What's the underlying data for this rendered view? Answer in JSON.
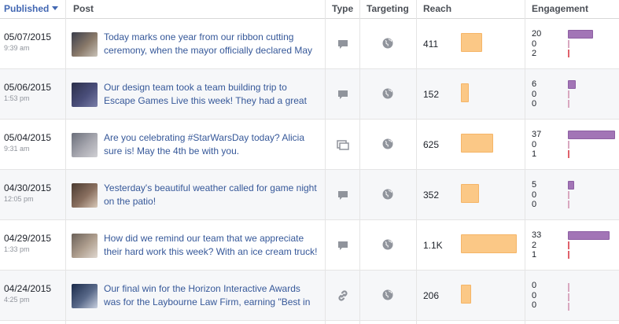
{
  "columns": {
    "published": "Published",
    "post": "Post",
    "type": "Type",
    "targeting": "Targeting",
    "reach": "Reach",
    "engagement": "Engagement"
  },
  "colors": {
    "accent": "#4267b2",
    "link": "#365899",
    "reach_bar": "#fbc886",
    "engagement_bar": "#a275b6"
  },
  "rows": [
    {
      "date": "05/07/2015",
      "time": "9:39 am",
      "line1": "Today marks one year from our ribbon cutting",
      "line2": "ceremony, when the mayor officially declared May",
      "type_icon": "status-icon",
      "targeting_icon": "globe-icon",
      "reach": "411",
      "reach_fraction": 0.38,
      "engagement": [
        "20",
        "0",
        "2"
      ],
      "engagement_fraction": 0.54
    },
    {
      "date": "05/06/2015",
      "time": "1:53 pm",
      "line1": "Our design team took a team building trip to",
      "line2": "Escape Games Live this week! They had a great",
      "type_icon": "status-icon",
      "targeting_icon": "globe-icon",
      "reach": "152",
      "reach_fraction": 0.14,
      "engagement": [
        "6",
        "0",
        "0"
      ],
      "engagement_fraction": 0.16
    },
    {
      "date": "05/04/2015",
      "time": "9:31 am",
      "line1": "Are you celebrating #StarWarsDay today? Alicia",
      "line2": "sure is! May the 4th be with you.",
      "type_icon": "photo-album-icon",
      "targeting_icon": "globe-icon",
      "reach": "625",
      "reach_fraction": 0.58,
      "engagement": [
        "37",
        "0",
        "1"
      ],
      "engagement_fraction": 1.0
    },
    {
      "date": "04/30/2015",
      "time": "12:05 pm",
      "line1": "Yesterday's beautiful weather called for game night",
      "line2": "on the patio!",
      "type_icon": "status-icon",
      "targeting_icon": "globe-icon",
      "reach": "352",
      "reach_fraction": 0.33,
      "engagement": [
        "5",
        "0",
        "0"
      ],
      "engagement_fraction": 0.14
    },
    {
      "date": "04/29/2015",
      "time": "1:33 pm",
      "line1": "How did we remind our team that we appreciate",
      "line2": "their hard work this week? With an ice cream truck!",
      "type_icon": "status-icon",
      "targeting_icon": "globe-icon",
      "reach": "1.1K",
      "reach_fraction": 1.0,
      "engagement": [
        "33",
        "2",
        "1"
      ],
      "engagement_fraction": 0.89
    },
    {
      "date": "04/24/2015",
      "time": "4:25 pm",
      "line1": "Our final win for the Horizon Interactive Awards",
      "line2": "was for the Laybourne Law Firm, earning \"Best in",
      "type_icon": "link-icon",
      "targeting_icon": "globe-icon",
      "reach": "206",
      "reach_fraction": 0.19,
      "engagement": [
        "0",
        "0",
        "0"
      ],
      "engagement_fraction": 0.0
    }
  ]
}
